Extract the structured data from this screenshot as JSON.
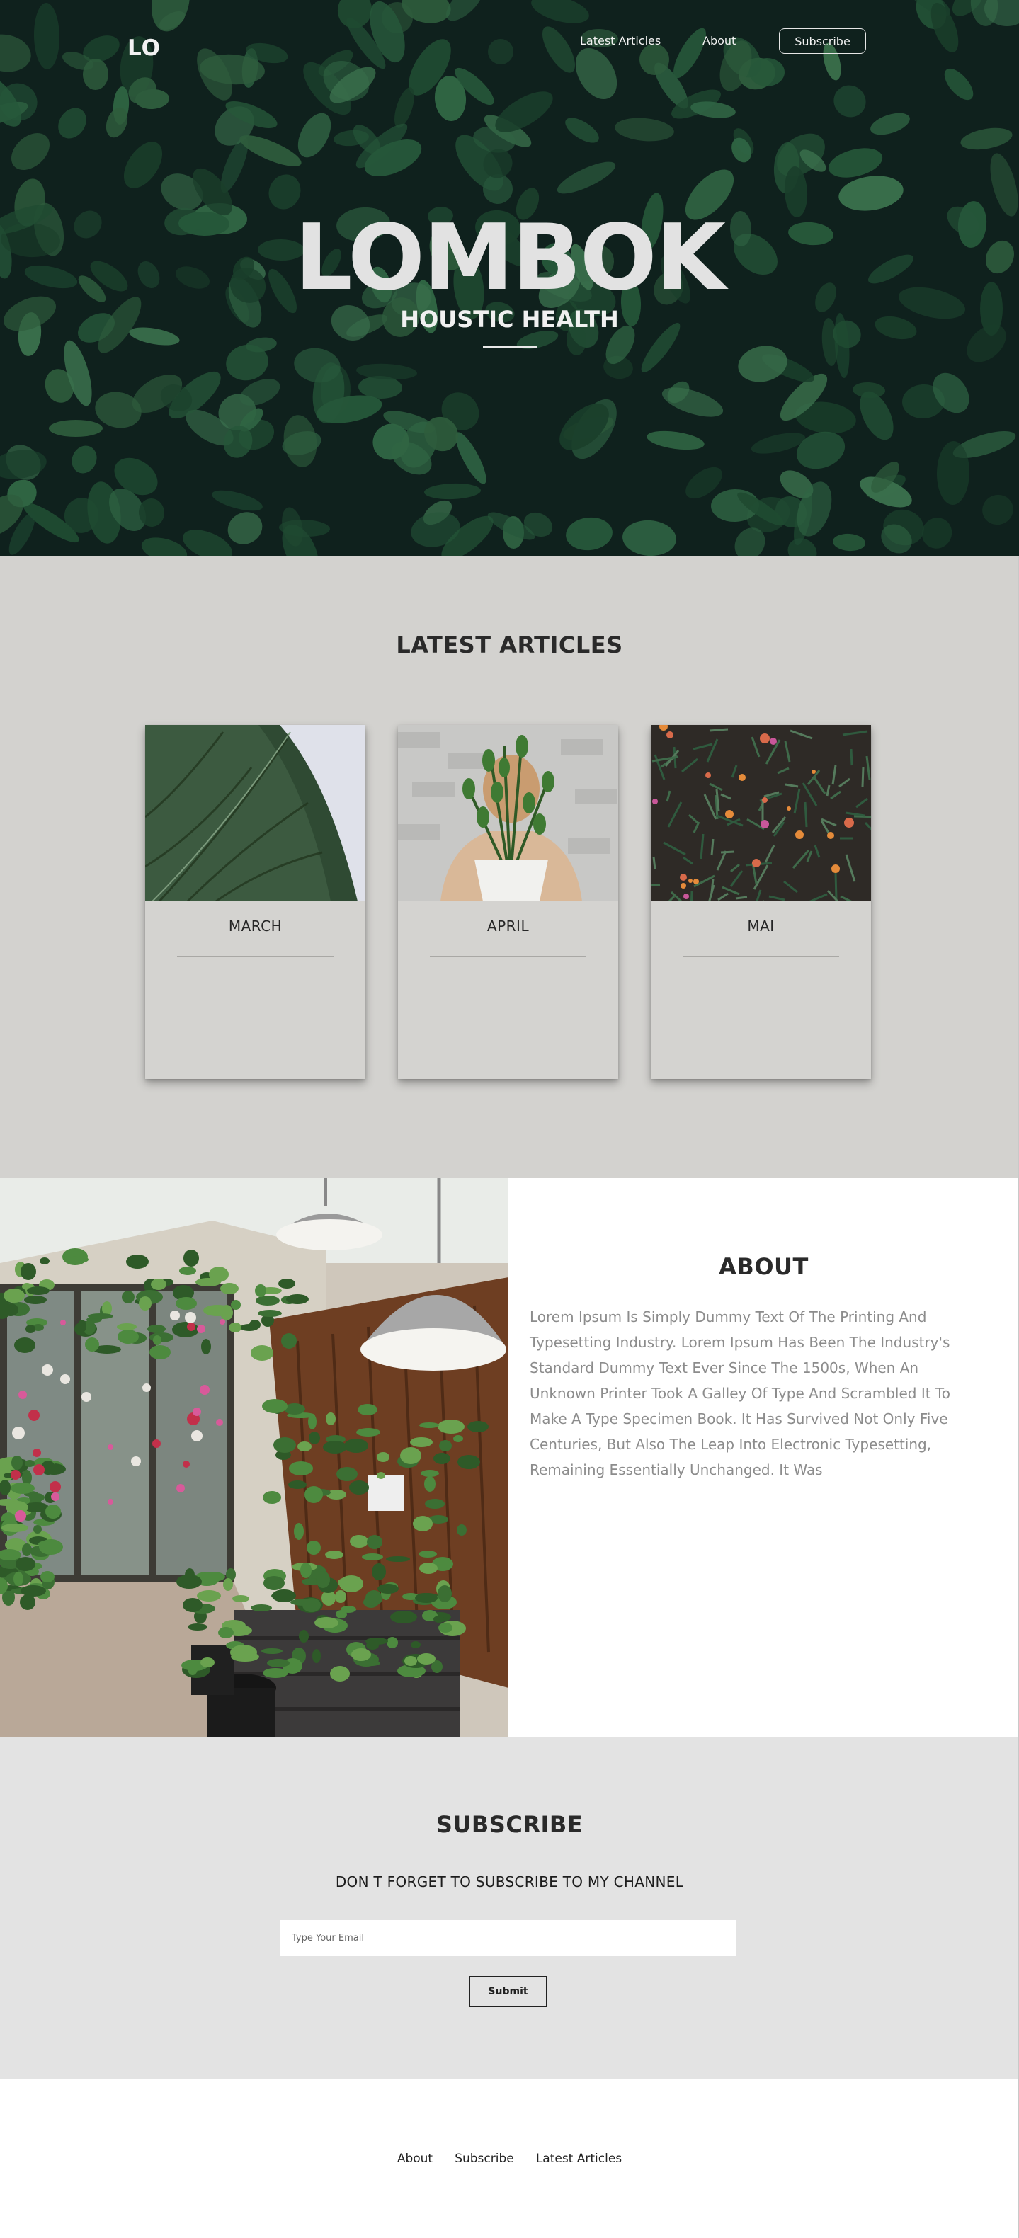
{
  "nav": {
    "logo": "LO",
    "links": [
      "Latest Articles",
      "About"
    ],
    "subscribe_label": "Subscribe"
  },
  "hero": {
    "title": "LOMBOK",
    "subtitle": "HOUSTIC HEALTH"
  },
  "articles": {
    "title": "LATEST ARTICLES",
    "cards": [
      {
        "label": "MARCH",
        "image": "monstera-leaf-image"
      },
      {
        "label": "APRIL",
        "image": "person-holding-potted-plant-image"
      },
      {
        "label": "MAI",
        "image": "flowering-bush-image"
      }
    ]
  },
  "about": {
    "title": "ABOUT",
    "text": "Lorem Ipsum Is Simply Dummy Text Of The Printing And Typesetting Industry. Lorem Ipsum Has Been The Industry's Standard Dummy Text Ever Since The 1500s, When An Unknown Printer Took A Galley Of Type And Scrambled It To Make A Type Specimen Book. It Has Survived Not Only Five Centuries, But Also The Leap Into Electronic Typesetting, Remaining Essentially Unchanged. It Was",
    "image": "plant-shop-greenhouse-image"
  },
  "subscribe": {
    "title": "SUBSCRIBE",
    "subtitle": "DON T FORGET TO SUBSCRIBE TO MY CHANNEL",
    "email_placeholder": "Type Your Email",
    "email_value": "",
    "submit_label": "Submit"
  },
  "footer": {
    "links": [
      "About",
      "Subscribe",
      "Latest Articles"
    ]
  },
  "colors": {
    "hero_bg": "#0f2420",
    "articles_bg": "#d3d2cf",
    "subscribe_bg": "#e3e3e3",
    "text_dark": "#222222",
    "text_muted": "#8c8c8c"
  }
}
